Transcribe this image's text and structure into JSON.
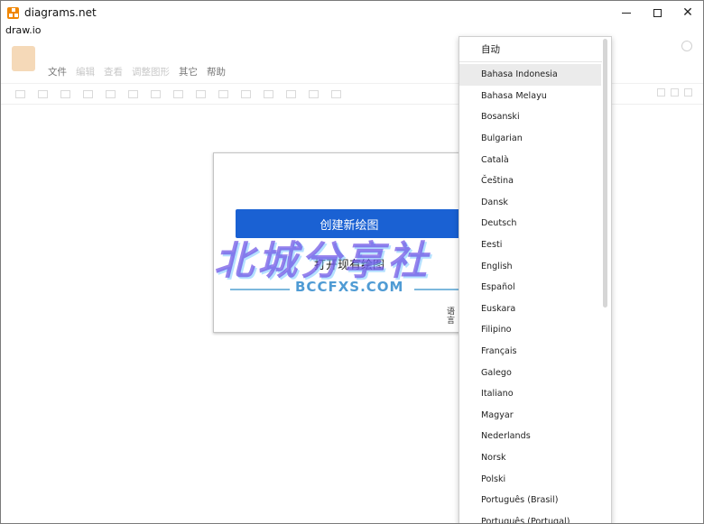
{
  "window": {
    "title": "diagrams.net",
    "subtitle": "draw.io",
    "minimize": "–",
    "maximize": "□",
    "close": "✕"
  },
  "app": {
    "menu": [
      "文件",
      "编辑",
      "查看",
      "调整图形",
      "其它",
      "帮助"
    ]
  },
  "dialog": {
    "create_label": "创建新绘图",
    "open_label": "打开现有绘图",
    "language_link": "语言"
  },
  "watermark": {
    "cn": "北城分享社",
    "en": "BCCFXS.COM"
  },
  "language_menu": {
    "auto": "自动",
    "items": [
      "Bahasa Indonesia",
      "Bahasa Melayu",
      "Bosanski",
      "Bulgarian",
      "Català",
      "Čeština",
      "Dansk",
      "Deutsch",
      "Eesti",
      "English",
      "Español",
      "Euskara",
      "Filipino",
      "Français",
      "Galego",
      "Italiano",
      "Magyar",
      "Nederlands",
      "Norsk",
      "Polski",
      "Português (Brasil)",
      "Português (Portugal)"
    ],
    "highlighted_index": 0
  },
  "colors": {
    "primary_button": "#1a61d3",
    "app_icon": "#f08705"
  }
}
